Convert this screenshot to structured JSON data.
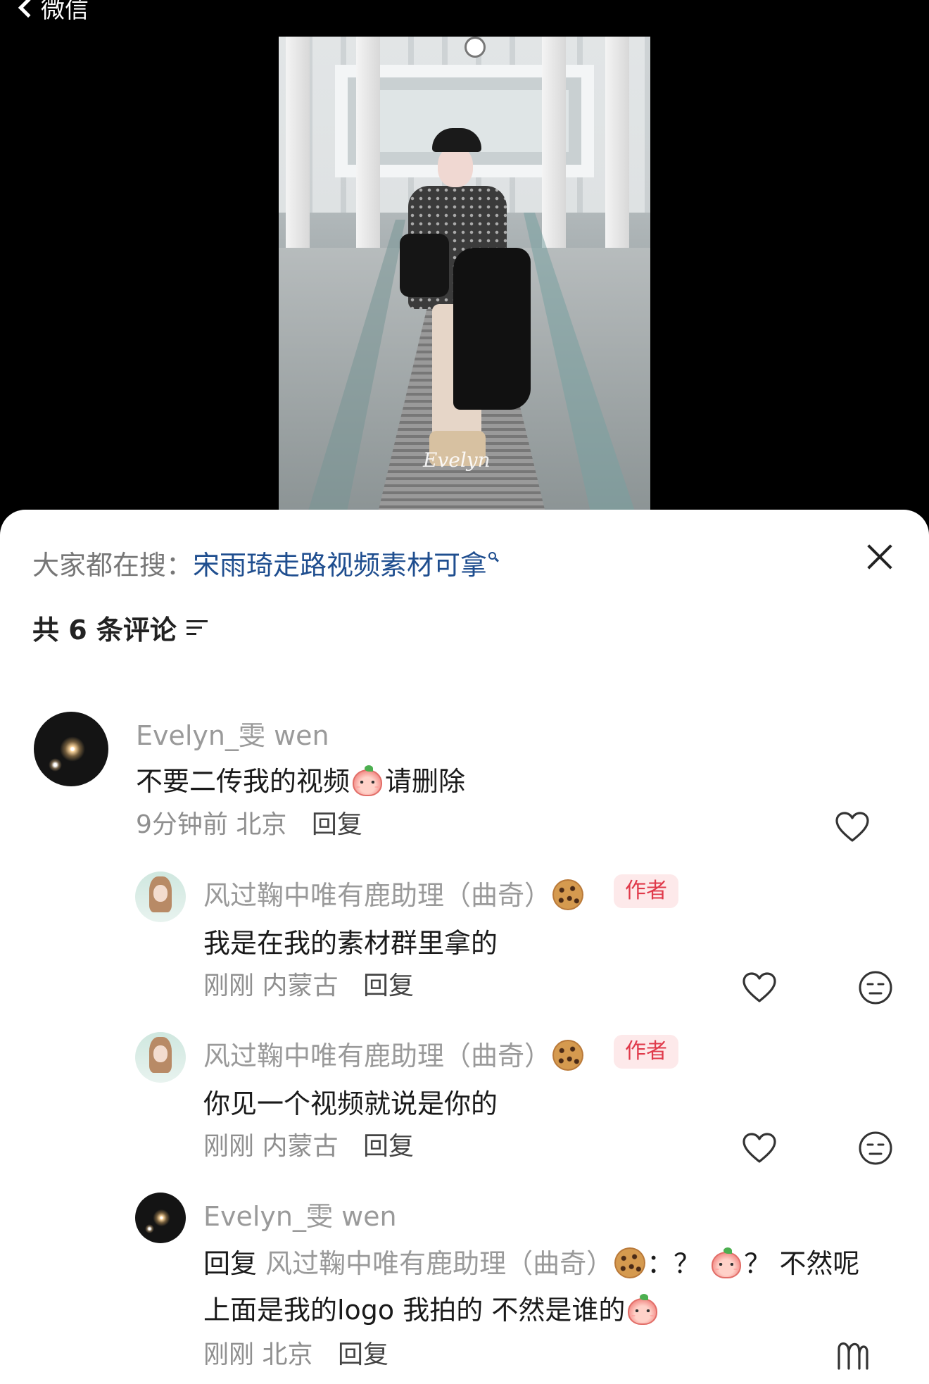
{
  "header": {
    "back_label": "微信"
  },
  "video": {
    "watermark": "Evelyn"
  },
  "sheet": {
    "search_prefix": "大家都在搜：",
    "search_query": "宋雨琦走路视频素材可拿",
    "comment_count_label": "共 6 条评论"
  },
  "comments": [
    {
      "name": "Evelyn_雯 wen",
      "text_before": "不要二传我的视频",
      "text_after": "请删除",
      "time": "9分钟前",
      "location": "北京",
      "reply_label": "回复"
    },
    {
      "name": "风过鞠中唯有鹿助理（曲奇）",
      "badge": "作者",
      "text": "我是在我的素材群里拿的",
      "time": "刚刚",
      "location": "内蒙古",
      "reply_label": "回复"
    },
    {
      "name": "风过鞠中唯有鹿助理（曲奇）",
      "badge": "作者",
      "text": "你见一个视频就说是你的",
      "time": "刚刚",
      "location": "内蒙古",
      "reply_label": "回复"
    },
    {
      "name": "Evelyn_雯 wen",
      "reply_prefix": "回复",
      "reply_to": "风过鞠中唯有鹿助理（曲奇）",
      "text_line1_a": "：？",
      "text_line1_b": "？ 不然呢",
      "text_line2": "上面是我的logo 我拍的 不然是谁的",
      "time": "刚刚",
      "location": "北京",
      "reply_label": "回复"
    }
  ],
  "icons": {
    "heart": "heart-outline-icon",
    "dislike": "dislike-face-icon",
    "close": "close-icon",
    "sort": "sort-icon",
    "peach_emoji": "peach-emoji",
    "cookie_emoji": "cookie-emoji"
  },
  "colors": {
    "search_link": "#1f4e8f",
    "badge_text": "#e0394a",
    "badge_bg": "#fde9ea",
    "muted_text": "#9a9a9a"
  }
}
